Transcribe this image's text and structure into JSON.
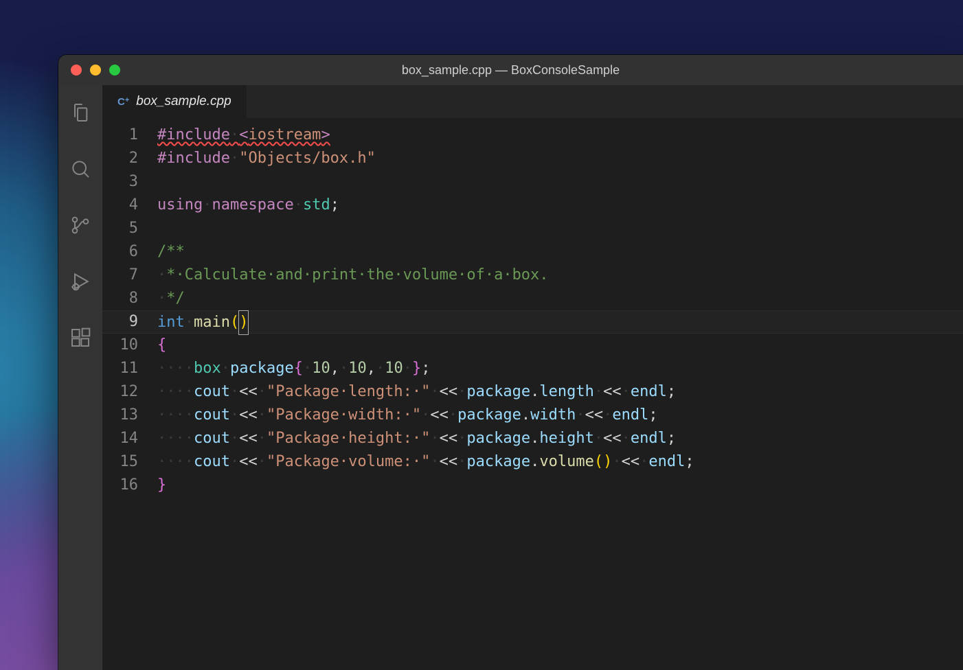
{
  "window": {
    "title": "box_sample.cpp — BoxConsoleSample"
  },
  "tab": {
    "filename": "box_sample.cpp",
    "lang_badge": "C",
    "lang_badge_plus": "+"
  },
  "activity": {
    "items": [
      "explorer",
      "search",
      "scm",
      "debug",
      "extensions"
    ]
  },
  "colors": {
    "keyword": "#c586c0",
    "type": "#569cd6",
    "type2": "#4ec9b0",
    "func": "#dcdcaa",
    "string": "#ce9178",
    "number": "#b5cea8",
    "comment": "#6a9955",
    "var": "#9cdcfe",
    "brace": "#da70d6",
    "paren": "#ffd602",
    "error_squiggle": "#f14c4c"
  },
  "editor": {
    "current_line": 9,
    "line_count": 16
  },
  "code": {
    "l1": {
      "include": "#include",
      "ws": "·",
      "lt": "<",
      "hdr": "iostream",
      "gt": ">"
    },
    "l2": {
      "include": "#include",
      "ws": "·",
      "str": "\"Objects/box.h\""
    },
    "l3": {
      "blank": ""
    },
    "l4": {
      "using": "using",
      "ws": "·",
      "namespace": "namespace",
      "ws2": "·",
      "std": "std",
      "semi": ";"
    },
    "l5": {
      "blank": ""
    },
    "l6": {
      "c": "/**"
    },
    "l7": {
      "guide": "·",
      "c": "*·Calculate·and·print·the·volume·of·a·box."
    },
    "l8": {
      "guide": "·",
      "c": "*/"
    },
    "l9": {
      "int": "int",
      "ws": "·",
      "main": "main",
      "lp": "(",
      "rp": ")"
    },
    "l10": {
      "brace": "{"
    },
    "l11": {
      "indent": "····",
      "box": "box",
      "ws": "·",
      "pkg": "package",
      "lb": "{",
      "sp": "·",
      "n1": "10",
      "c1": ",",
      "s2": "·",
      "n2": "10",
      "c2": ",",
      "s3": "·",
      "n3": "10",
      "s4": "·",
      "rb": "}",
      "semi": ";"
    },
    "l12": {
      "indent": "····",
      "cout": "cout",
      "ws": "·",
      "op1": "<<",
      "ws2": "·",
      "str": "\"Package·length:·\"",
      "ws3": "·",
      "op2": "<<",
      "ws4": "·",
      "pkg": "package",
      "dot": ".",
      "mem": "length",
      "ws5": "·",
      "op3": "<<",
      "ws6": "·",
      "endl": "endl",
      "semi": ";"
    },
    "l13": {
      "indent": "····",
      "cout": "cout",
      "ws": "·",
      "op1": "<<",
      "ws2": "·",
      "str": "\"Package·width:·\"",
      "ws3": "·",
      "op2": "<<",
      "ws4": "·",
      "pkg": "package",
      "dot": ".",
      "mem": "width",
      "ws5": "·",
      "op3": "<<",
      "ws6": "·",
      "endl": "endl",
      "semi": ";"
    },
    "l14": {
      "indent": "····",
      "cout": "cout",
      "ws": "·",
      "op1": "<<",
      "ws2": "·",
      "str": "\"Package·height:·\"",
      "ws3": "·",
      "op2": "<<",
      "ws4": "·",
      "pkg": "package",
      "dot": ".",
      "mem": "height",
      "ws5": "·",
      "op3": "<<",
      "ws6": "·",
      "endl": "endl",
      "semi": ";"
    },
    "l15": {
      "indent": "····",
      "cout": "cout",
      "ws": "·",
      "op1": "<<",
      "ws2": "·",
      "str": "\"Package·volume:·\"",
      "ws3": "·",
      "op2": "<<",
      "ws4": "·",
      "pkg": "package",
      "dot": ".",
      "mem": "volume",
      "lp": "(",
      "rp": ")",
      "ws5": "·",
      "op3": "<<",
      "ws6": "·",
      "endl": "endl",
      "semi": ";"
    },
    "l16": {
      "brace": "}"
    }
  },
  "line_numbers": [
    "1",
    "2",
    "3",
    "4",
    "5",
    "6",
    "7",
    "8",
    "9",
    "10",
    "11",
    "12",
    "13",
    "14",
    "15",
    "16"
  ]
}
